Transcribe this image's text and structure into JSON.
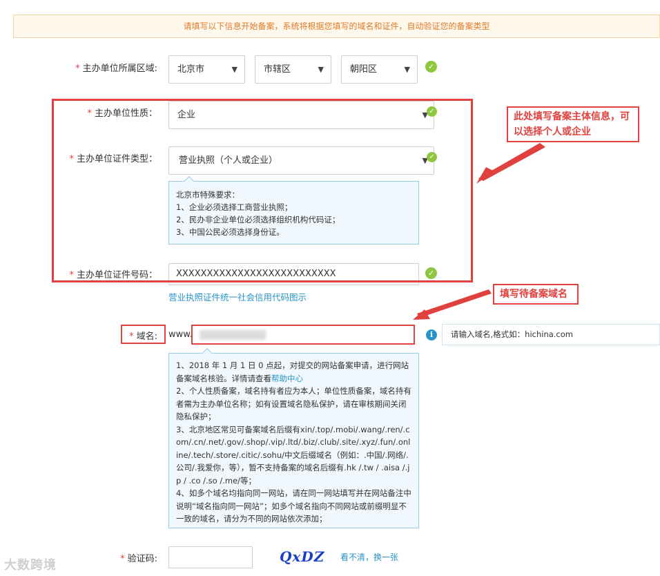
{
  "notice": "请填写以下信息开始备案，系统将根据您填写的域名和证件，自动验证您的备案类型",
  "required_mark": "*",
  "region": {
    "label": "主办单位所属区域:",
    "province": "北京市",
    "city": "市辖区",
    "district": "朝阳区"
  },
  "nature": {
    "label": "主办单位性质：",
    "value": "企业"
  },
  "cert_type": {
    "label": "主办单位证件类型：",
    "value": "营业执照（个人或企业）",
    "notes": [
      "北京市特殊要求：",
      "1、企业必须选择工商营业执照；",
      "2、民办非企业单位必须选择组织机构代码证；",
      "3、中国公民必须选择身份证。"
    ]
  },
  "cert_number": {
    "label": "主办单位证件号码：",
    "value": "XXXXXXXXXXXXXXXXXXXXXXXXXX",
    "sample_link": "营业执照证件统一社会信用代码图示"
  },
  "domain": {
    "label": "域名:",
    "prefix": "www.",
    "tip": "请输入域名,格式如：hichina.com",
    "notes": {
      "line1_pre": "1、2018 年 1 月 1 日 0 点起，对提交的网站备案申请，进行网站备案域名核验。详情请查看",
      "line1_link": "帮助中心",
      "line2": "2、个人性质备案，域名持有者应为本人；单位性质备案，域名持有者需为主办单位名称；如有设置域名隐私保护，请在审核期间关闭隐私保护；",
      "line3": "3、北京地区常见可备案域名后缀有xin/.top/.mobi/.wang/.ren/.com/.cn/.net/.gov/.shop/.vip/.ltd/.biz/.club/.site/.xyz/.fun/.online/.tech/.store/.citic/.sohu/中文后缀域名（例如：.中国/.网络/.公司/.我爱你，等），暂不支持备案的域名后缀有.hk /.tw / .aisa /.jp / .co /.so /.me/等；",
      "line4": "4、如多个域名均指向同一网站，请在同一网站填写并在网站备注中说明“域名指向同一网站”；如多个域名指向不同网站或前缀明显不一致的域名，请分为不同的网站依次添加；"
    }
  },
  "captcha": {
    "label": "验证码:",
    "image_text": "QxDZ",
    "refresh": "看不清，换一张"
  },
  "annotations": {
    "subject": "此处填写备案主体信息，可以选择个人或企业",
    "domain": "填写待备案域名"
  },
  "watermark": "大数跨境",
  "colors": {
    "accent_red": "#e0413e",
    "success_green": "#8dc63f",
    "link_blue": "#2a94c8",
    "notice_orange": "#e07b2a"
  }
}
